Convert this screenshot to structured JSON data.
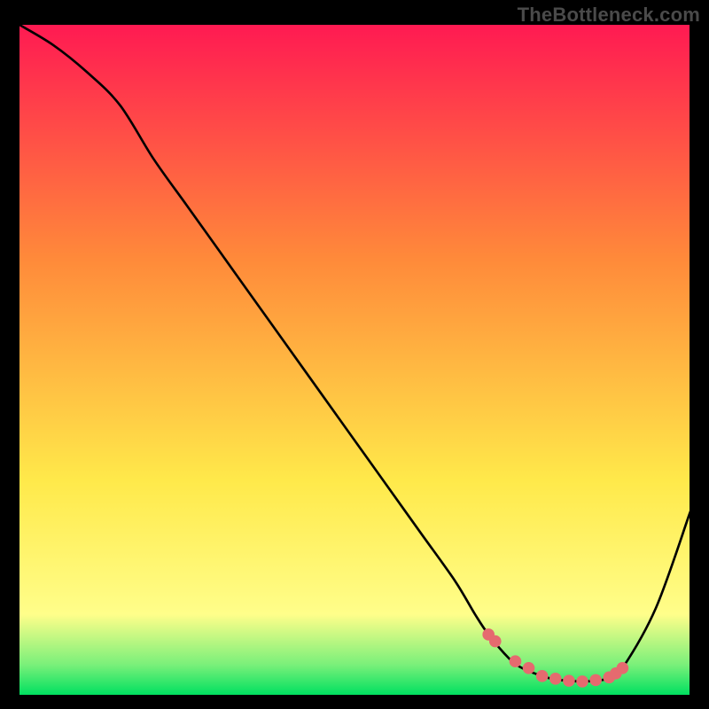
{
  "watermark": "TheBottleneck.com",
  "colors": {
    "bg": "#000000",
    "watermark": "#4a4a4a",
    "curve": "#000000",
    "dot": "#e56a6f",
    "grad_top": "#ff1a52",
    "grad_mid1": "#ff8a3a",
    "grad_mid2": "#ffe94a",
    "grad_low": "#fffe8a",
    "grad_green1": "#7af07a",
    "grad_green2": "#00e060"
  },
  "chart_data": {
    "type": "line",
    "title": "",
    "xlabel": "",
    "ylabel": "",
    "xlim": [
      0,
      100
    ],
    "ylim": [
      0,
      100
    ],
    "series": [
      {
        "name": "bottleneck-curve",
        "x": [
          0,
          5,
          10,
          15,
          20,
          25,
          30,
          35,
          40,
          45,
          50,
          55,
          60,
          65,
          68,
          70,
          73,
          75,
          78,
          80,
          82,
          84,
          86,
          88,
          90,
          95,
          100
        ],
        "y": [
          100,
          97,
          93,
          88,
          80,
          73,
          66,
          59,
          52,
          45,
          38,
          31,
          24,
          17,
          12,
          9,
          5.5,
          4,
          2.8,
          2.3,
          2.1,
          2.0,
          2.1,
          2.5,
          4,
          13,
          27
        ]
      }
    ],
    "highlight_points": {
      "name": "optimal-zone-dots",
      "x": [
        70,
        71,
        74,
        76,
        78,
        80,
        82,
        84,
        86,
        88,
        89,
        90
      ],
      "y": [
        9,
        8,
        5,
        4,
        2.8,
        2.4,
        2.1,
        2.0,
        2.2,
        2.6,
        3.2,
        4.0
      ]
    }
  }
}
